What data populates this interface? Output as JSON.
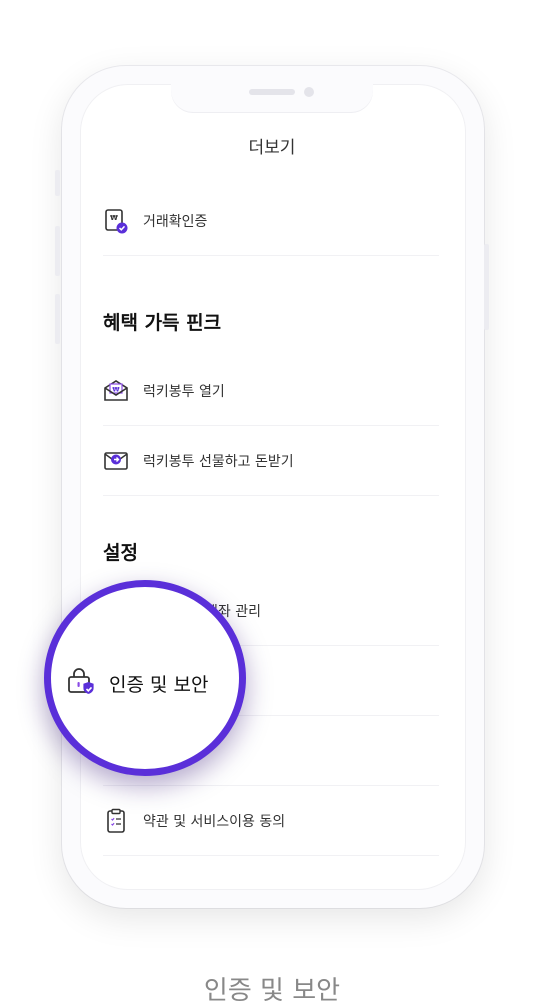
{
  "header": {
    "title": "더보기"
  },
  "items": {
    "trade_auth": "거래확인증",
    "lucky_open": "럭키봉투 열기",
    "lucky_gift": "럭키봉투 선물하고 돈받기",
    "account_manage": "계좌 관리",
    "auth_security": "인증 및 보안",
    "terms": "약관 및 서비스이용 동의"
  },
  "sections": {
    "benefits": "혜택 가득 핀크",
    "settings": "설정"
  },
  "magnifier": {
    "label": "인증 및 보안"
  },
  "caption": "인증 및 보안",
  "colors": {
    "accent": "#5a2fd9",
    "purple_light": "#8a4be6"
  }
}
